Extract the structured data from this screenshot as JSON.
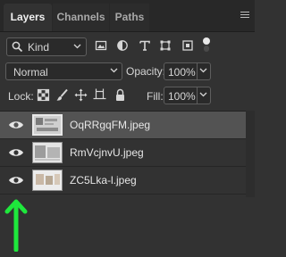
{
  "tabs": [
    {
      "label": "Layers",
      "active": true
    },
    {
      "label": "Channels",
      "active": false
    },
    {
      "label": "Paths",
      "active": false
    }
  ],
  "filter": {
    "kind_label": "Kind",
    "icons": [
      "image-filter-icon",
      "adjustment-filter-icon",
      "type-filter-icon",
      "shape-filter-icon",
      "smart-object-filter-icon",
      "filter-toggle-icon"
    ]
  },
  "blend": {
    "mode": "Normal",
    "opacity_label": "Opacity:",
    "opacity_value": "100%"
  },
  "lock": {
    "label": "Lock:",
    "icons": [
      "lock-transparent-pixels-icon",
      "lock-image-pixels-icon",
      "lock-position-icon",
      "lock-artboard-icon",
      "lock-all-icon"
    ],
    "fill_label": "Fill:",
    "fill_value": "100%"
  },
  "layers": [
    {
      "name": "OqRRgqFM.jpeg",
      "visible": true,
      "selected": true
    },
    {
      "name": "RmVcjnvU.jpeg",
      "visible": true,
      "selected": false
    },
    {
      "name": "ZC5Lka-l.jpeg",
      "visible": true,
      "selected": false
    }
  ],
  "colors": {
    "panel_bg": "#323232",
    "selected_row": "#535353",
    "arrow": "#1ee83c"
  }
}
